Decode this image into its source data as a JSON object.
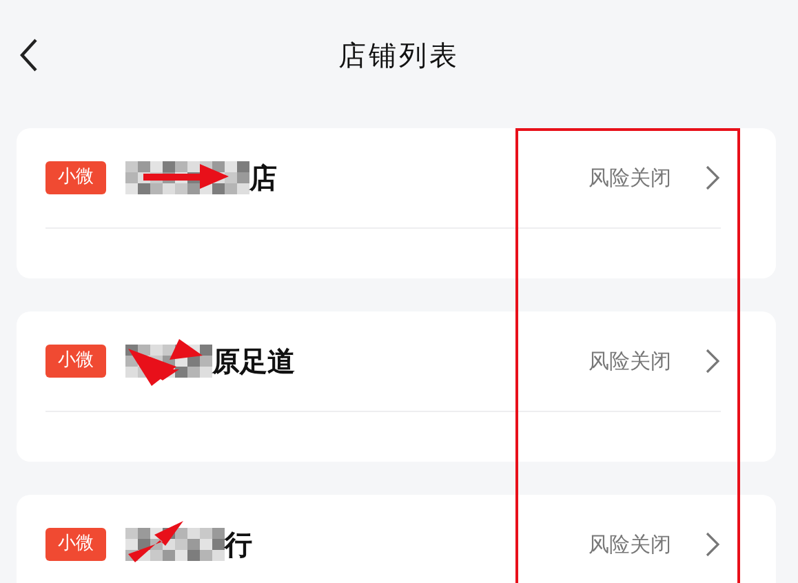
{
  "header": {
    "title": "店铺列表"
  },
  "stores": [
    {
      "badge": "小微",
      "name": "店",
      "status": "风险关闭"
    },
    {
      "badge": "小微",
      "name": "原足道",
      "status": "风险关闭"
    },
    {
      "badge": "小微",
      "name": "行",
      "status": "风险关闭"
    }
  ]
}
